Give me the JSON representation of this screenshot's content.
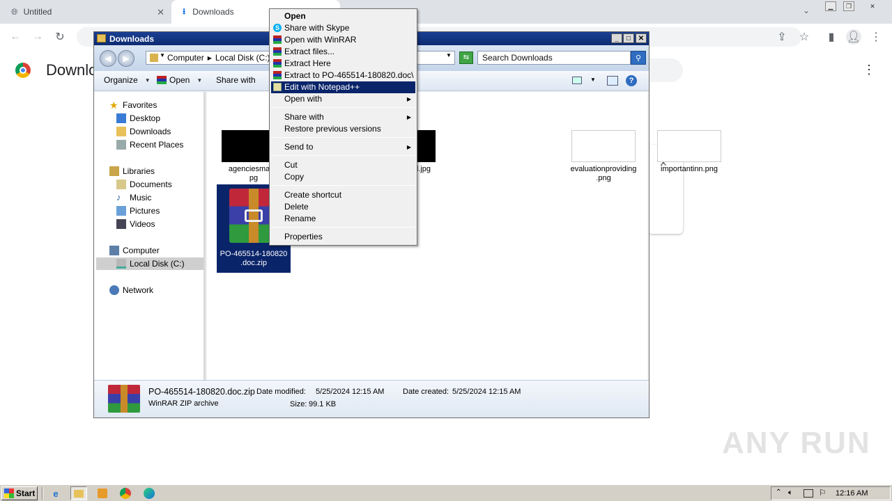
{
  "chrome": {
    "tabs": [
      {
        "label": "Untitled",
        "close": "✕"
      },
      {
        "label": "Downloads",
        "close": "✕"
      }
    ],
    "page_title": "Downlo",
    "dismiss": "✕"
  },
  "explorer": {
    "title": "Downloads",
    "breadcrumb": [
      "Computer",
      "Local Disk (C:)"
    ],
    "search_placeholder": "Search Downloads",
    "commands": [
      "Organize",
      "Open",
      "Share with"
    ],
    "nav": {
      "favorites": {
        "label": "Favorites",
        "items": [
          "Desktop",
          "Downloads",
          "Recent Places"
        ]
      },
      "libraries": {
        "label": "Libraries",
        "items": [
          "Documents",
          "Music",
          "Pictures",
          "Videos"
        ]
      },
      "computer": {
        "label": "Computer",
        "items": [
          "Local Disk (C:)"
        ]
      },
      "network": "Network"
    },
    "files": [
      {
        "name_line1": "agenciesmater",
        "name_line2": "pg"
      },
      {
        "name_line1": "allyhold.jpg",
        "name_line2": ""
      },
      {
        "name_line1": "evaluationproviding",
        "name_line2": ".png"
      },
      {
        "name_line1": "importantinn.png",
        "name_line2": ""
      },
      {
        "name_line1": "PO-465514-180820",
        "name_line2": ".doc.zip"
      }
    ],
    "details": {
      "filename": "PO-465514-180820.doc.zip",
      "type": "WinRAR ZIP archive",
      "modified_label": "Date modified:",
      "modified": "5/25/2024 12:15 AM",
      "created_label": "Date created:",
      "created": "5/25/2024 12:15 AM",
      "size_label": "Size:",
      "size": "99.1 KB"
    }
  },
  "context_menu": {
    "items": [
      {
        "label": "Open",
        "bold": true
      },
      {
        "label": "Share with Skype"
      },
      {
        "label": "Open with WinRAR"
      },
      {
        "label": "Extract files..."
      },
      {
        "label": "Extract Here"
      },
      {
        "label": "Extract to PO-465514-180820.doc\\"
      },
      {
        "label": "Edit with Notepad++",
        "highlighted": true
      },
      {
        "label": "Open with",
        "submenu": true
      },
      {
        "label": "Share with",
        "submenu": true
      },
      {
        "label": "Restore previous versions"
      },
      {
        "label": "Send to",
        "submenu": true
      },
      {
        "label": "Cut"
      },
      {
        "label": "Copy"
      },
      {
        "label": "Create shortcut"
      },
      {
        "label": "Delete"
      },
      {
        "label": "Rename"
      },
      {
        "label": "Properties"
      }
    ]
  },
  "taskbar": {
    "start": "Start",
    "clock": "12:16 AM"
  },
  "watermark": "ANY RUN"
}
